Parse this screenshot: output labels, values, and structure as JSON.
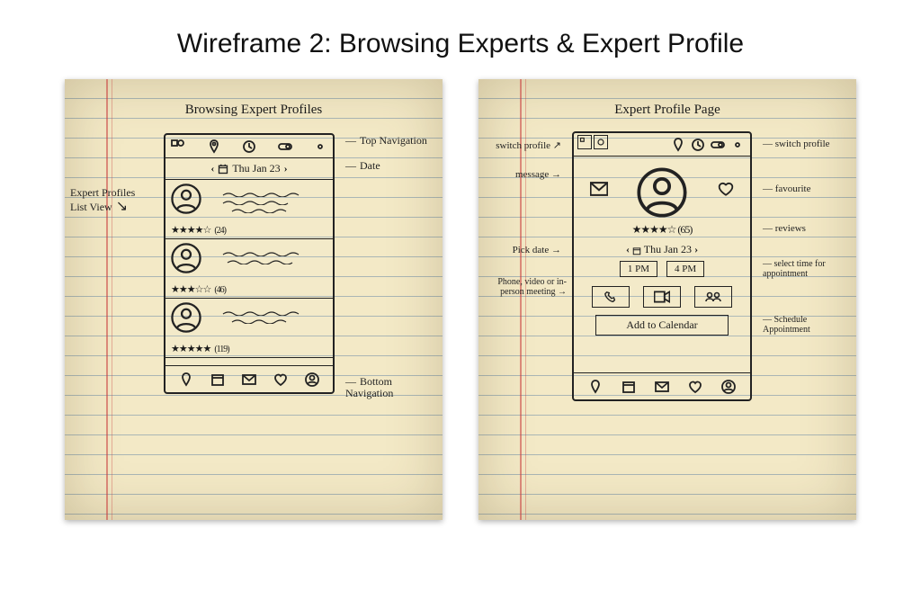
{
  "title": "Wireframe 2: Browsing Experts & Expert Profile",
  "left": {
    "heading": "Browsing Expert Profiles",
    "date": "Thu Jan 23",
    "items": [
      {
        "ratingCount": "(24)"
      },
      {
        "ratingCount": "(46)"
      },
      {
        "ratingCount": "(119)"
      }
    ],
    "anno": {
      "topnav": "Top Navigation",
      "date": "Date",
      "list": "Expert Profiles List View",
      "botnav": "Bottom Navigation"
    }
  },
  "right": {
    "heading": "Expert Profile Page",
    "ratingCount": "(65)",
    "date": "Thu Jan 23",
    "times": [
      "1 PM",
      "4 PM"
    ],
    "addCalendar": "Add to Calendar",
    "anno": {
      "switchProfileL": "switch profile",
      "message": "message",
      "pickDate": "Pick date",
      "meeting": "Phone, video or in-person meeting",
      "switchProfileR": "switch profile",
      "favourite": "favourite",
      "reviews": "reviews",
      "selectTime": "select time for appointment",
      "schedule": "Schedule Appointment"
    }
  }
}
